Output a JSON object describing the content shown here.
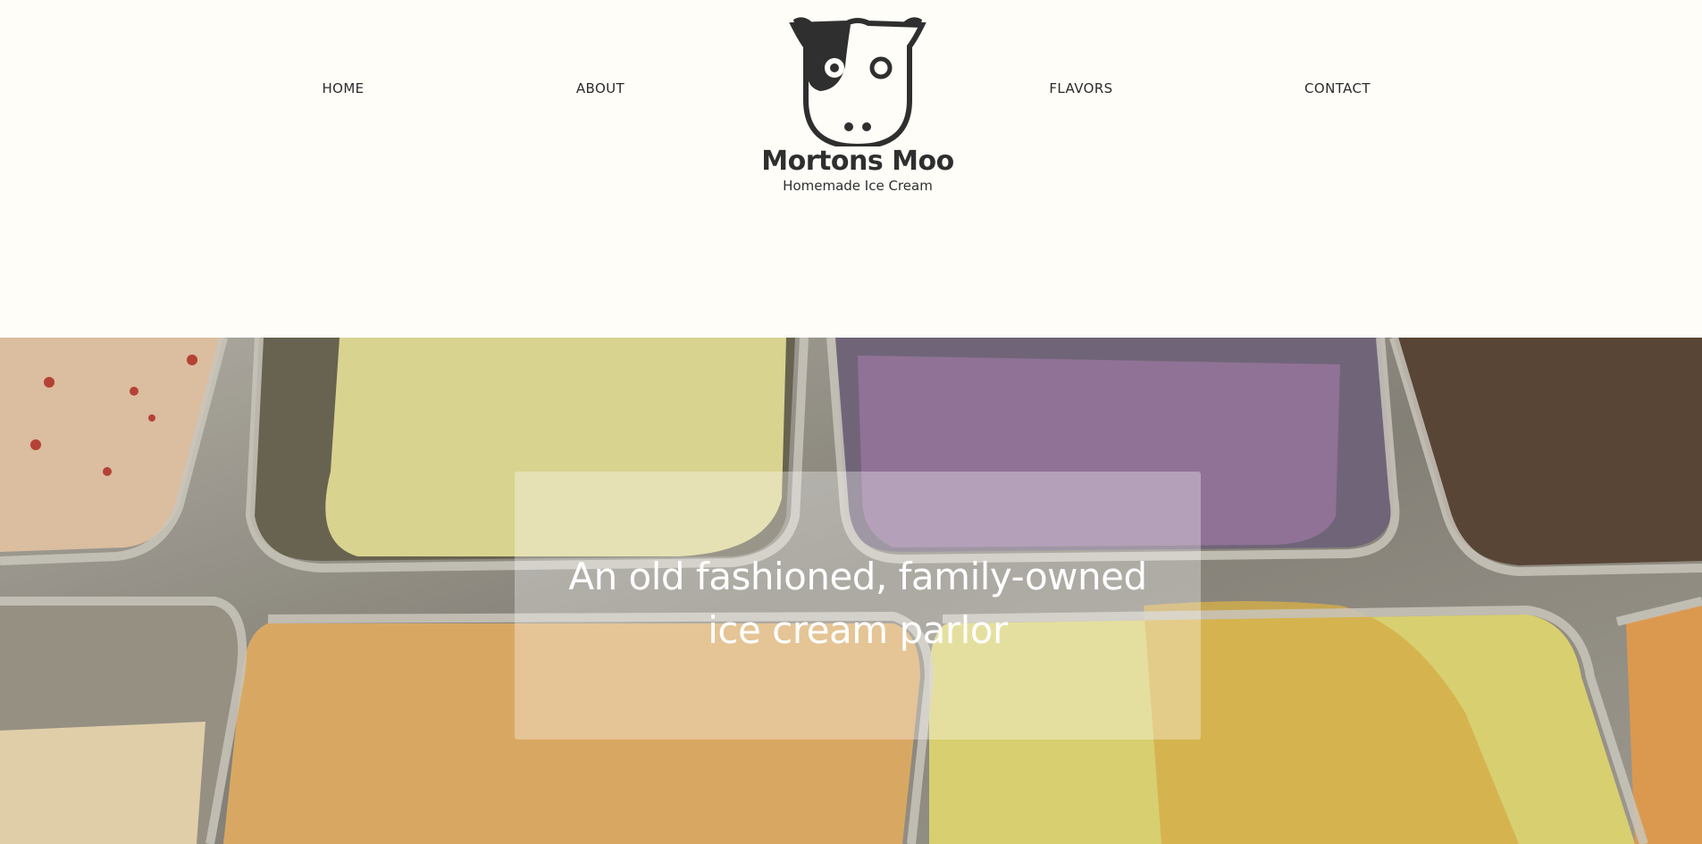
{
  "nav": {
    "home": "HOME",
    "about": "ABOUT",
    "flavors": "FLAVORS",
    "contact": "CONTACT"
  },
  "logo": {
    "icon": "cow-face-icon",
    "name": "Mortons Moo",
    "tagline": "Homemade Ice Cream"
  },
  "hero": {
    "image": "ice-cream-tubs-photo",
    "headline_line1": "An old fashioned, family-owned",
    "headline_line2": "ice cream parlor"
  },
  "colors": {
    "background": "#fefdf8",
    "text": "#2b2b2b",
    "logo": "#2f2f2f"
  }
}
